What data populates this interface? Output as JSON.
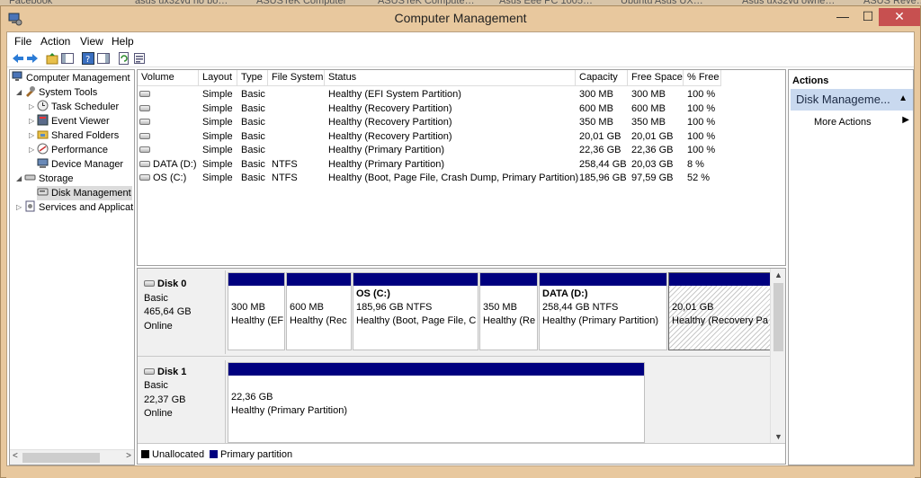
{
  "browser_tabs": [
    "Facebook",
    "asus ux32vd no bo…",
    "ASUSTeK Computer",
    "ASUSTeK Compute…",
    "Asus Eee PC 1005…",
    "Ubuntu Asus UX…",
    "Asus ux32vd owne…",
    "ASUS Reve…"
  ],
  "window": {
    "title": "Computer Management",
    "minimize": "—",
    "maximize": "☐",
    "close": "✕"
  },
  "menu": [
    "File",
    "Action",
    "View",
    "Help"
  ],
  "tree": {
    "root": "Computer Management",
    "system_tools": "System Tools",
    "task_scheduler": "Task Scheduler",
    "event_viewer": "Event Viewer",
    "shared_folders": "Shared Folders",
    "performance": "Performance",
    "device_manager": "Device Manager",
    "storage": "Storage",
    "disk_management": "Disk Management",
    "services": "Services and Applicat"
  },
  "volume_list": {
    "columns": [
      "Volume",
      "Layout",
      "Type",
      "File System",
      "Status",
      "Capacity",
      "Free Space",
      "% Free"
    ],
    "rows": [
      {
        "volume": "",
        "layout": "Simple",
        "type": "Basic",
        "fs": "",
        "status": "Healthy (EFI System Partition)",
        "capacity": "300 MB",
        "free": "300 MB",
        "pct": "100 %"
      },
      {
        "volume": "",
        "layout": "Simple",
        "type": "Basic",
        "fs": "",
        "status": "Healthy (Recovery Partition)",
        "capacity": "600 MB",
        "free": "600 MB",
        "pct": "100 %"
      },
      {
        "volume": "",
        "layout": "Simple",
        "type": "Basic",
        "fs": "",
        "status": "Healthy (Recovery Partition)",
        "capacity": "350 MB",
        "free": "350 MB",
        "pct": "100 %"
      },
      {
        "volume": "",
        "layout": "Simple",
        "type": "Basic",
        "fs": "",
        "status": "Healthy (Recovery Partition)",
        "capacity": "20,01 GB",
        "free": "20,01 GB",
        "pct": "100 %"
      },
      {
        "volume": "",
        "layout": "Simple",
        "type": "Basic",
        "fs": "",
        "status": "Healthy (Primary Partition)",
        "capacity": "22,36 GB",
        "free": "22,36 GB",
        "pct": "100 %"
      },
      {
        "volume": "DATA (D:)",
        "layout": "Simple",
        "type": "Basic",
        "fs": "NTFS",
        "status": "Healthy (Primary Partition)",
        "capacity": "258,44 GB",
        "free": "20,03 GB",
        "pct": "8 %"
      },
      {
        "volume": "OS (C:)",
        "layout": "Simple",
        "type": "Basic",
        "fs": "NTFS",
        "status": "Healthy (Boot, Page File, Crash Dump, Primary Partition)",
        "capacity": "185,96 GB",
        "free": "97,59 GB",
        "pct": "52 %"
      }
    ]
  },
  "disks": {
    "disk0": {
      "name": "Disk 0",
      "type": "Basic",
      "size": "465,64 GB",
      "state": "Online",
      "partitions": [
        {
          "label": "",
          "size": "300 MB",
          "status": "Healthy (EF"
        },
        {
          "label": "",
          "size": "600 MB",
          "status": "Healthy (Rec"
        },
        {
          "label": "OS  (C:)",
          "size": "185,96 GB NTFS",
          "status": "Healthy (Boot, Page File, C"
        },
        {
          "label": "",
          "size": "350 MB",
          "status": "Healthy (Re"
        },
        {
          "label": "DATA  (D:)",
          "size": "258,44 GB NTFS",
          "status": "Healthy (Primary Partition)"
        },
        {
          "label": "",
          "size": "20,01 GB",
          "status": "Healthy (Recovery Pa"
        }
      ]
    },
    "disk1": {
      "name": "Disk 1",
      "type": "Basic",
      "size": "22,37 GB",
      "state": "Online",
      "partitions": [
        {
          "label": "",
          "size": "22,36 GB",
          "status": "Healthy (Primary Partition)"
        }
      ]
    }
  },
  "legend": {
    "unallocated": "Unallocated",
    "primary": "Primary partition",
    "unallocated_color": "#000000",
    "primary_color": "#00007f"
  },
  "actions": {
    "header": "Actions",
    "section": "Disk Manageme...",
    "more_actions": "More Actions"
  }
}
